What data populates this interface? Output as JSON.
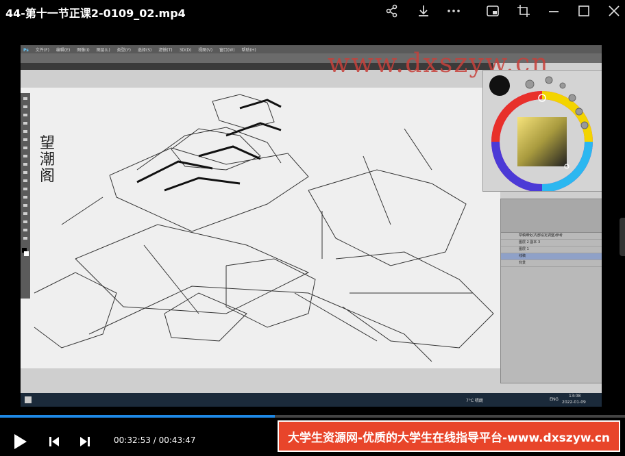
{
  "window": {
    "title": "44-第十一节正课2-0109_02.mp4"
  },
  "toolbar_icons": [
    "share-icon",
    "download-icon",
    "more-icon",
    "picture-in-picture-icon",
    "crop-icon",
    "minimize-icon",
    "maximize-icon",
    "close-icon"
  ],
  "video": {
    "watermark": "www.dxszyw.cn",
    "calligraphy": "望潮阁",
    "photoshop": {
      "logo": "Ps",
      "menus": [
        "文件(F)",
        "编辑(E)",
        "图像(I)",
        "图层(L)",
        "类型(Y)",
        "选择(S)",
        "滤镜(T)",
        "3D(D)",
        "视图(V)",
        "窗口(W)",
        "帮助(H)"
      ],
      "layers": [
        {
          "name": "草稿细化(内部设定调整)参考",
          "selected": false
        },
        {
          "name": "图层 2 副本 3",
          "selected": false
        },
        {
          "name": "图层 1",
          "selected": false
        },
        {
          "name": "线稿",
          "selected": true
        },
        {
          "name": "背景",
          "selected": false
        }
      ]
    },
    "taskbar": {
      "weather": "7°C 晴朗",
      "lang": "ENG",
      "time": "13:08",
      "date": "2022-01-09"
    }
  },
  "player": {
    "current_time": "00:32:53",
    "total_time": "00:43:47",
    "time_separator": " / ",
    "progress_fraction": 0.44,
    "accent_color": "#1e88e5"
  },
  "banner": {
    "text": "大学生资源网-优质的大学生在线指导平台-www.dxszyw.cn",
    "color": "#e8452a"
  }
}
